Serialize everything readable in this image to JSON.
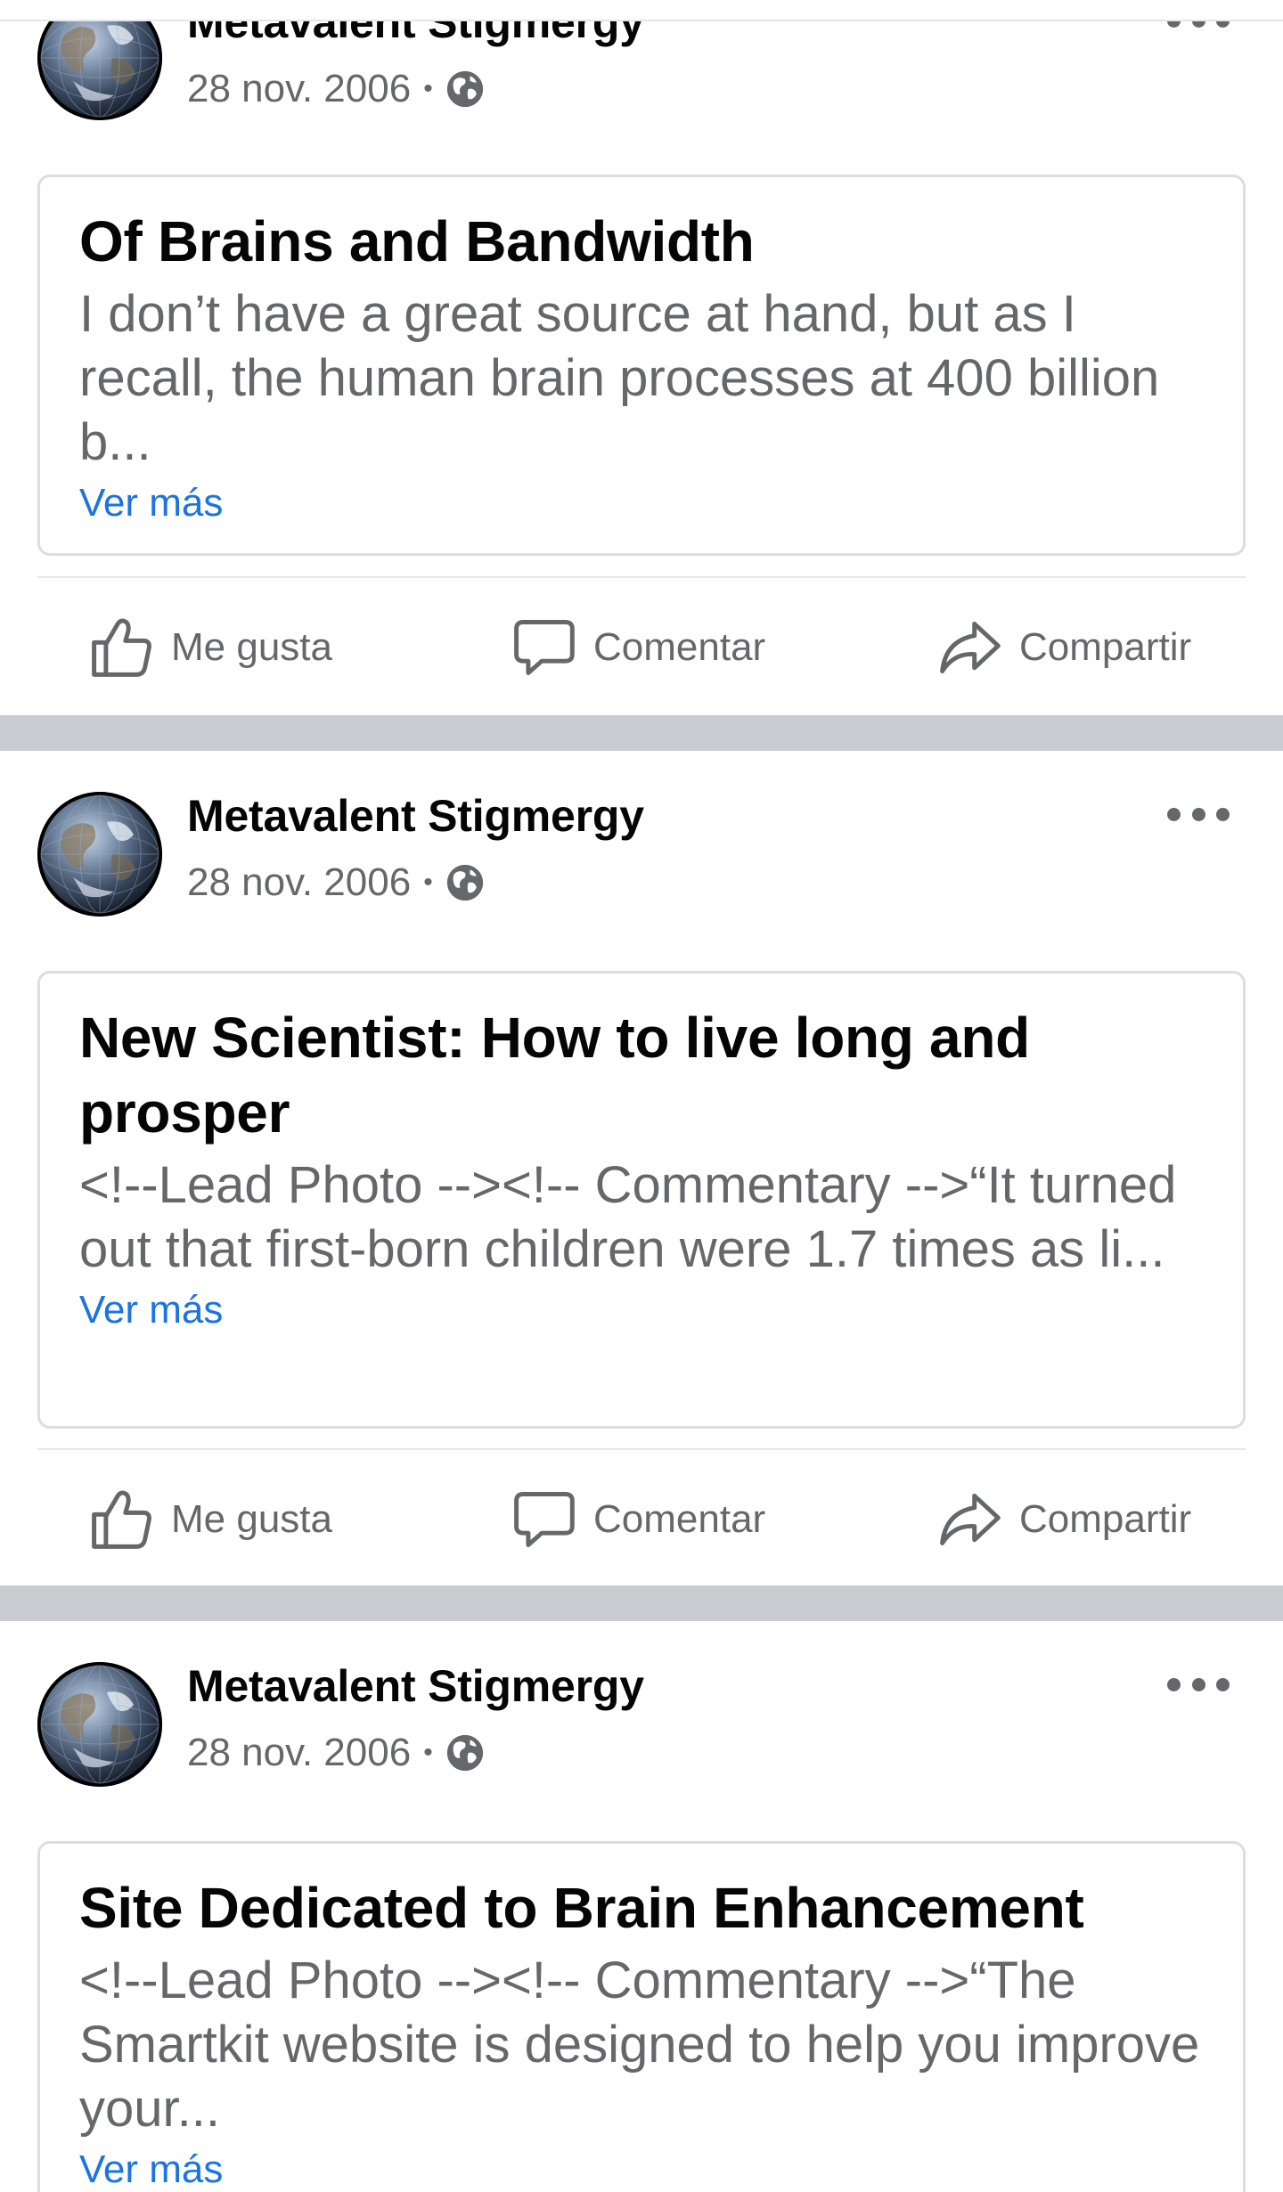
{
  "posts": [
    {
      "author": "Metavalent Stigmergy",
      "date": "28 nov. 2006",
      "separator": "•",
      "card": {
        "title": "Of Brains and Bandwidth",
        "excerpt": "I don’t have a great source at hand, but as I recall, the human  brain processes at  400 billion b...",
        "see_more": "Ver más"
      },
      "actions": {
        "like": "Me gusta",
        "comment": "Comentar",
        "share": "Compartir"
      }
    },
    {
      "author": "Metavalent Stigmergy",
      "date": "28 nov. 2006",
      "separator": "•",
      "card": {
        "title": "New Scientist: How to live long and prosper",
        "excerpt": "<!--Lead Photo --><!-- Commentary -->“It turned out that  first-born children were 1.7 times as li...",
        "see_more": "Ver más"
      },
      "actions": {
        "like": "Me gusta",
        "comment": "Comentar",
        "share": "Compartir"
      }
    },
    {
      "author": "Metavalent Stigmergy",
      "date": "28 nov. 2006",
      "separator": "•",
      "card": {
        "title": "Site Dedicated to Brain Enhancement",
        "excerpt": "<!--Lead Photo --><!-- Commentary -->“The Smartkit website  is designed to help you improve your...",
        "see_more": "Ver más"
      }
    }
  ],
  "icons": {
    "avatar": "earth-globe-avatar",
    "privacy": "globe-icon",
    "more": "more-options-icon",
    "like": "thumbs-up-icon",
    "comment": "comment-bubble-icon",
    "share": "share-arrow-icon"
  },
  "colors": {
    "link": "#1b74e4",
    "secondary_text": "#65676b",
    "feed_divider": "#c9ccd1"
  }
}
